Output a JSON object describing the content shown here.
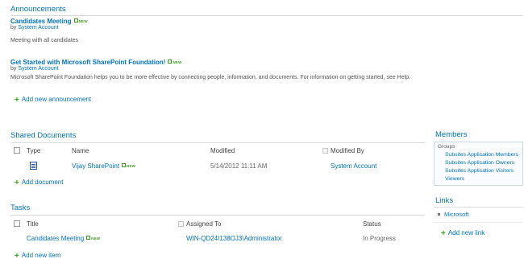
{
  "announcements": {
    "title": "Announcements",
    "items": [
      {
        "title": "Candidates Meeting",
        "new": "NEW",
        "by_prefix": "by",
        "author": "System Account",
        "body": "Meeting with all candidates"
      },
      {
        "title": "Get Started with Microsoft SharePoint Foundation!",
        "new": "NEW",
        "by_prefix": "by",
        "author": "System Account",
        "body": "Microsoft SharePoint Foundation helps you to be more effective by connecting people, information, and documents. For information on getting started, see Help."
      }
    ],
    "add_label": "Add new announcement"
  },
  "shared_documents": {
    "title": "Shared Documents",
    "columns": {
      "type": "Type",
      "name": "Name",
      "modified": "Modified",
      "modified_by": "Modified By"
    },
    "rows": [
      {
        "icon": "word-document-icon",
        "name": "Vijay SharePoint",
        "new": "NEW",
        "modified": "5/14/2012 11:11 AM",
        "modified_by": "System Account"
      }
    ],
    "add_label": "Add document"
  },
  "tasks": {
    "title": "Tasks",
    "columns": {
      "title": "Title",
      "assigned_to": "Assigned To",
      "status": "Status"
    },
    "rows": [
      {
        "title": "Candidates Meeting",
        "new": "NEW",
        "assigned_to": "WIN-QD24I138OJ3\\Administrator",
        "status": "In Progress"
      }
    ],
    "add_label": "Add new item"
  },
  "members": {
    "title": "Members",
    "groups_label": "Groups",
    "groups": [
      "Subsites Application Members",
      "Subsites Application Owners",
      "Subsites Application Visitors",
      "Viewers"
    ]
  },
  "links": {
    "title": "Links",
    "items": [
      "Microsoft"
    ],
    "add_label": "Add new link"
  },
  "colors": {
    "link": "#0072bc",
    "new_badge": "#3a9a1a",
    "add_plus": "#36a31f"
  }
}
